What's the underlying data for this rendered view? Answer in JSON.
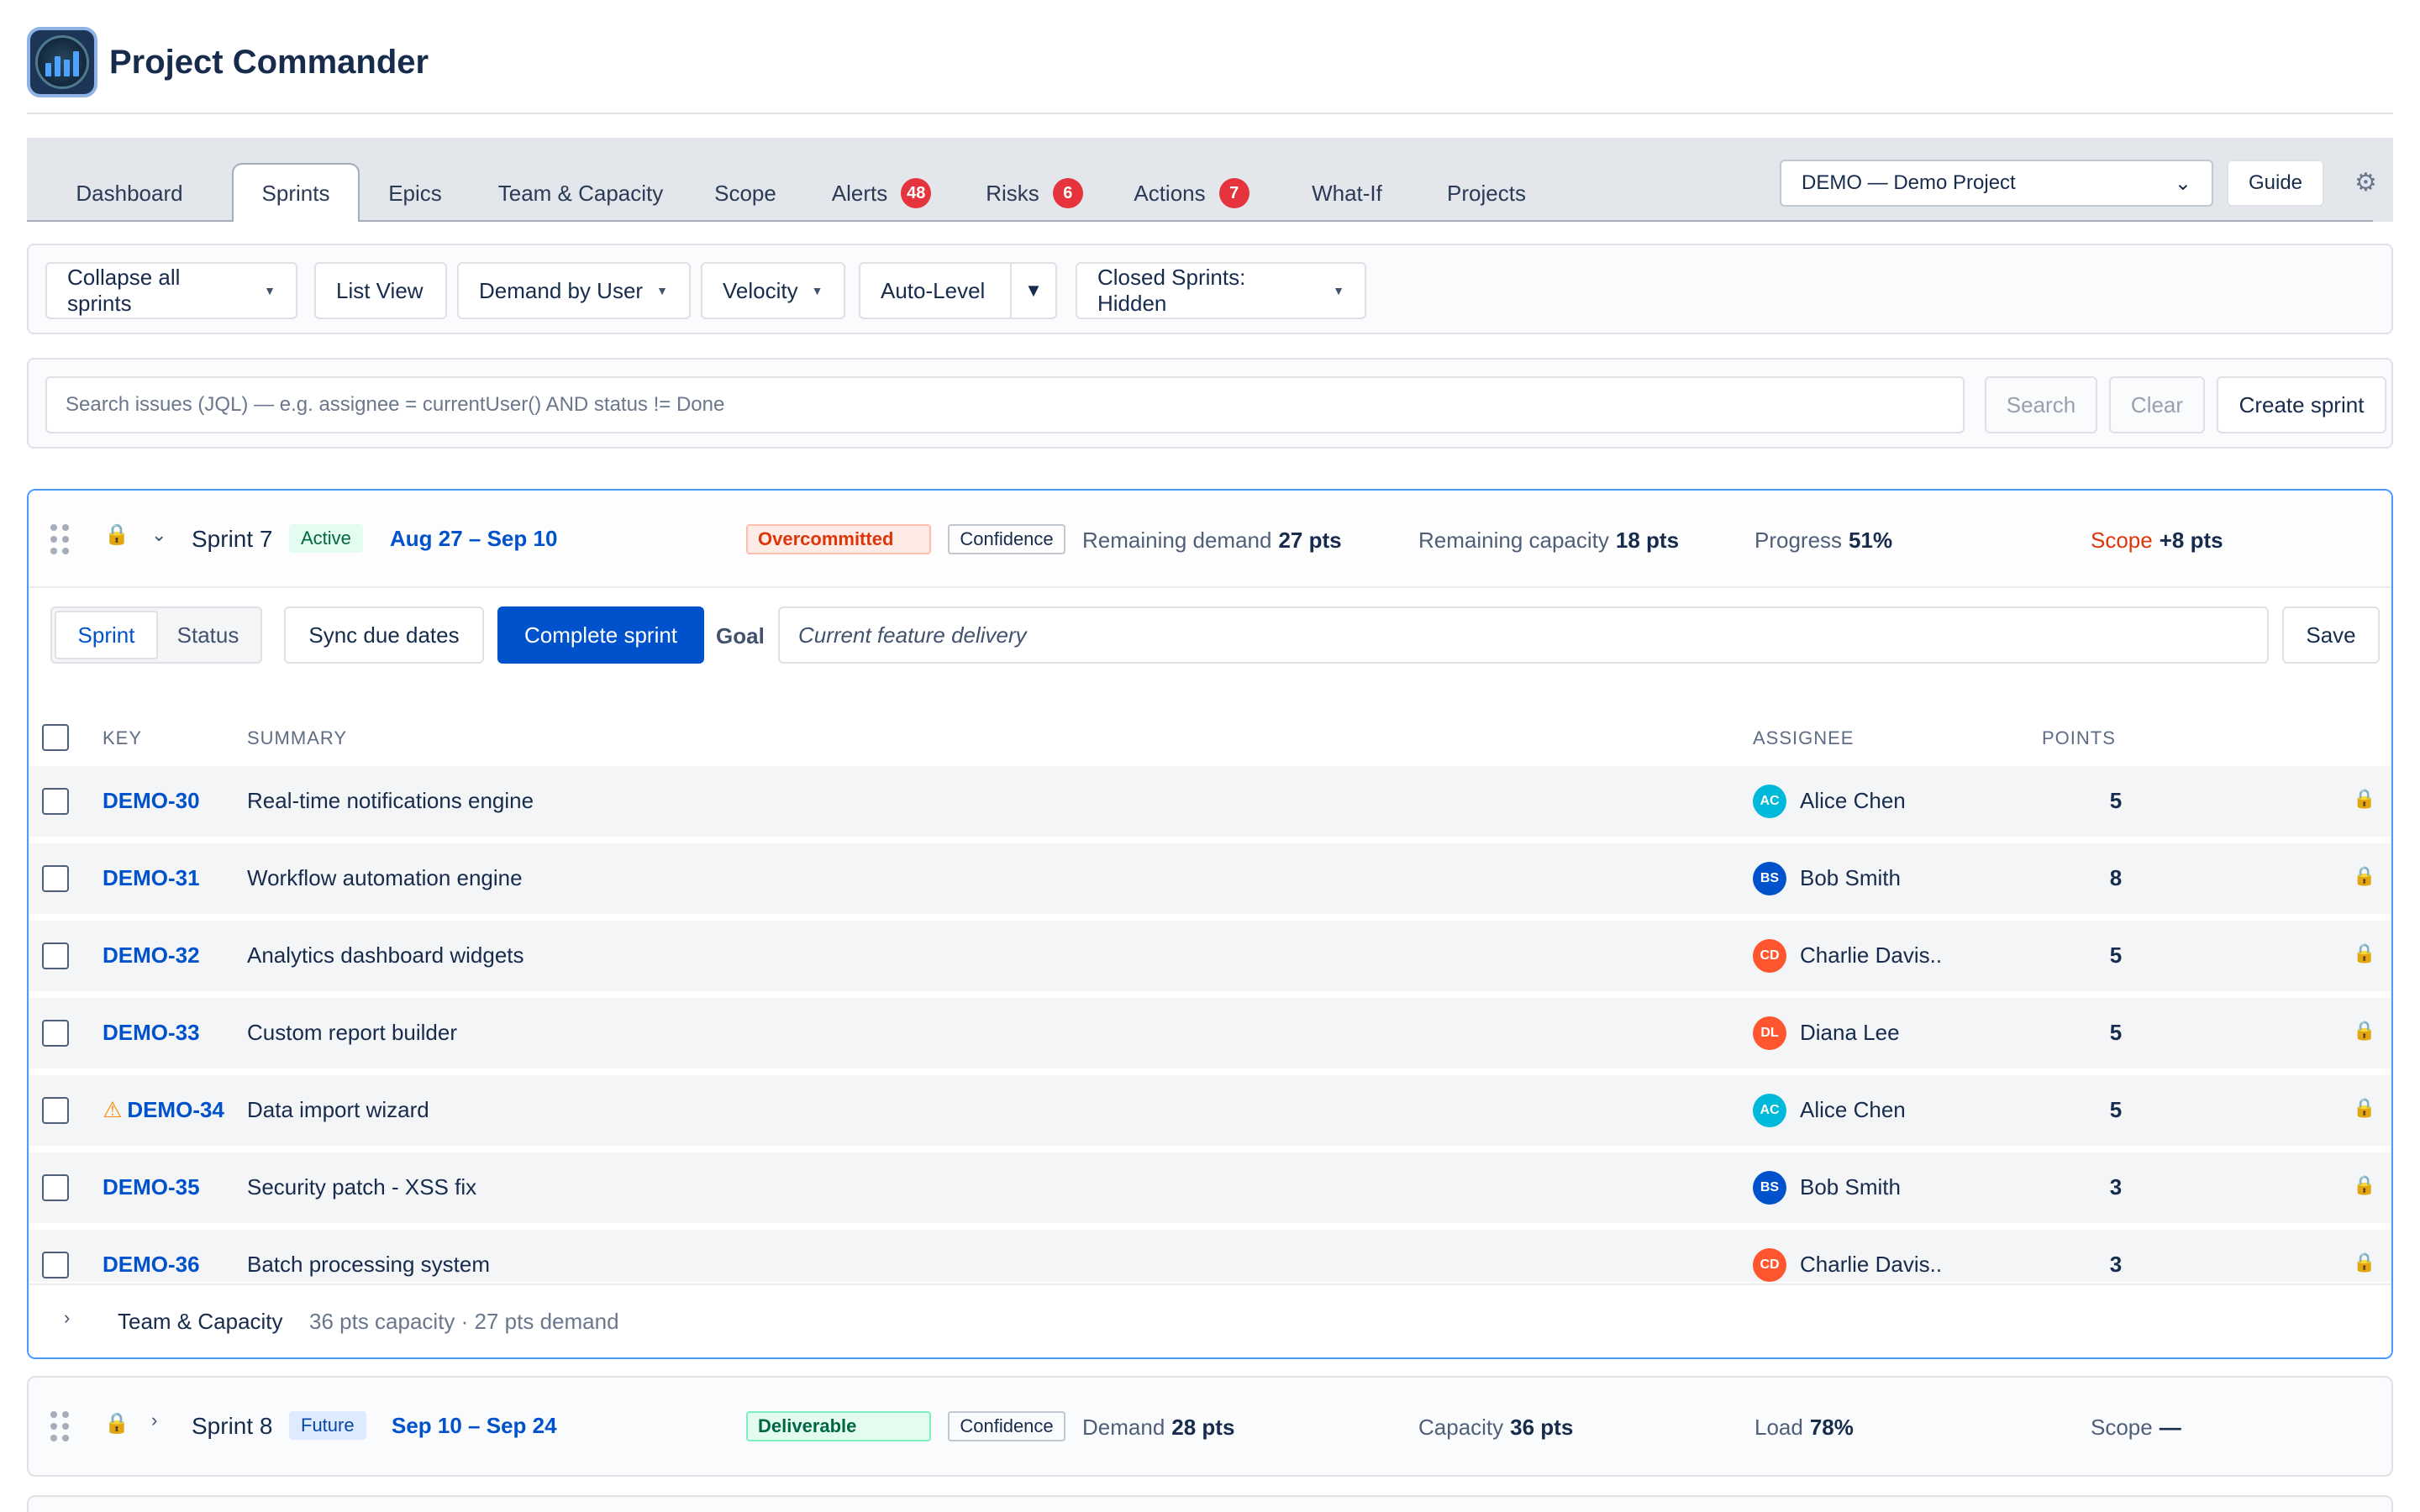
{
  "app": {
    "title": "Project Commander"
  },
  "tabs": [
    {
      "label": "Dashboard"
    },
    {
      "label": "Sprints",
      "active": true
    },
    {
      "label": "Epics"
    },
    {
      "label": "Team & Capacity"
    },
    {
      "label": "Scope"
    },
    {
      "label": "Alerts",
      "badge": "48"
    },
    {
      "label": "Risks",
      "badge": "6"
    },
    {
      "label": "Actions",
      "badge": "7"
    },
    {
      "label": "What-If"
    },
    {
      "label": "Projects"
    }
  ],
  "project_select": {
    "value": "DEMO — Demo Project"
  },
  "guide_label": "Guide",
  "toolbar": {
    "collapse_all": "Collapse all sprints",
    "list_view": "List View",
    "demand_by_user": "Demand by User",
    "velocity": "Velocity",
    "auto_level": "Auto-Level",
    "closed_sprints": "Closed Sprints: Hidden"
  },
  "search": {
    "placeholder": "Search issues (JQL) — e.g. assignee = currentUser() AND status != Done",
    "search_label": "Search",
    "clear_label": "Clear",
    "create_label": "Create sprint"
  },
  "sprint7": {
    "name": "Sprint 7",
    "state": "Active",
    "dates": "Aug 27 – Sep 10",
    "status": "Overcommitted",
    "confidence": "Confidence",
    "remaining_demand_label": "Remaining demand",
    "remaining_demand": "27 pts",
    "remaining_capacity_label": "Remaining capacity",
    "remaining_capacity": "18 pts",
    "progress_label": "Progress",
    "progress": "51%",
    "scope_label": "Scope",
    "scope": "+8 pts",
    "view_toggle": {
      "sprint": "Sprint",
      "status": "Status"
    },
    "sync_label": "Sync due dates",
    "complete_label": "Complete sprint",
    "goal_label": "Goal",
    "goal_value": "Current feature delivery",
    "save_label": "Save",
    "columns": {
      "key": "KEY",
      "summary": "SUMMARY",
      "assignee": "ASSIGNEE",
      "points": "POINTS"
    },
    "issues": [
      {
        "key": "DEMO-30",
        "summary": "Real-time notifications engine",
        "initials": "AC",
        "assignee": "Alice Chen",
        "points": "5",
        "color": "#00b8d9",
        "warn": false
      },
      {
        "key": "DEMO-31",
        "summary": "Workflow automation engine",
        "initials": "BS",
        "assignee": "Bob Smith",
        "points": "8",
        "color": "#0052cc",
        "warn": false
      },
      {
        "key": "DEMO-32",
        "summary": "Analytics dashboard widgets",
        "initials": "CD",
        "assignee": "Charlie Davis..",
        "points": "5",
        "color": "#ff5630",
        "warn": false
      },
      {
        "key": "DEMO-33",
        "summary": "Custom report builder",
        "initials": "DL",
        "assignee": "Diana Lee",
        "points": "5",
        "color": "#ff5630",
        "warn": false
      },
      {
        "key": "DEMO-34",
        "summary": "Data import wizard",
        "initials": "AC",
        "assignee": "Alice Chen",
        "points": "5",
        "color": "#00b8d9",
        "warn": true
      },
      {
        "key": "DEMO-35",
        "summary": "Security patch - XSS fix",
        "initials": "BS",
        "assignee": "Bob Smith",
        "points": "3",
        "color": "#0052cc",
        "warn": false
      },
      {
        "key": "DEMO-36",
        "summary": "Batch processing system",
        "initials": "CD",
        "assignee": "Charlie Davis..",
        "points": "3",
        "color": "#ff5630",
        "warn": false
      }
    ],
    "team": {
      "label": "Team & Capacity",
      "info": "36 pts capacity · 27 pts demand"
    }
  },
  "sprint8": {
    "name": "Sprint 8",
    "state": "Future",
    "dates": "Sep 10 – Sep 24",
    "status": "Deliverable",
    "confidence": "Confidence",
    "demand_label": "Demand",
    "demand": "28 pts",
    "capacity_label": "Capacity",
    "capacity": "36 pts",
    "load_label": "Load",
    "load": "78%",
    "scope_label": "Scope",
    "scope": "—"
  }
}
